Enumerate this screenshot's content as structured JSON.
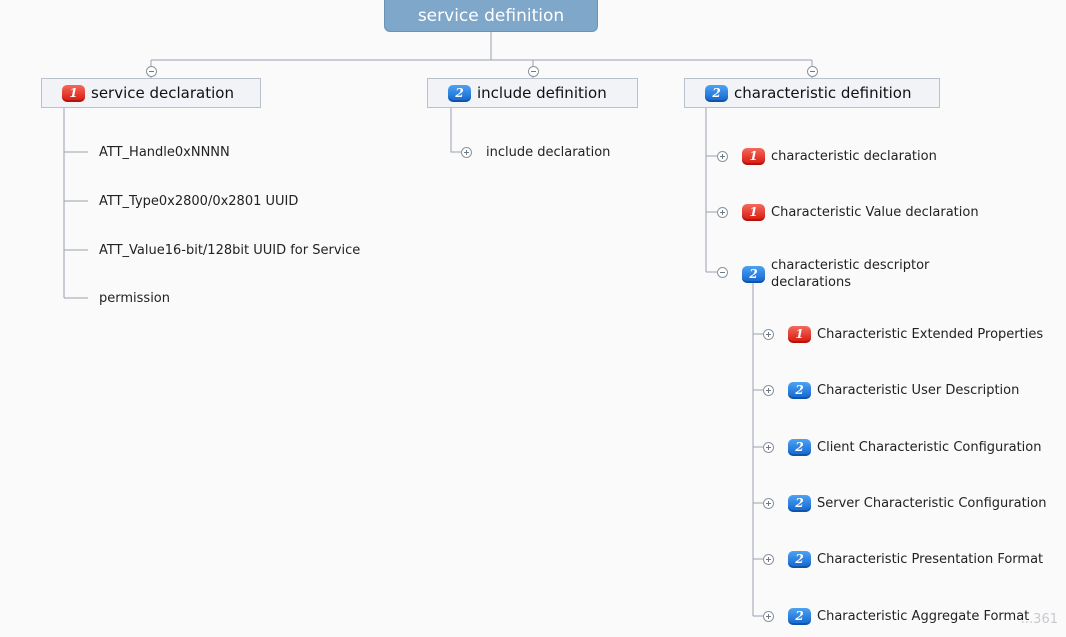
{
  "root": {
    "label": "service definition"
  },
  "branches": {
    "service_declaration": {
      "label": "service declaration",
      "badge": "1",
      "children": [
        "ATT_Handle0xNNNN",
        "ATT_Type0x2800/0x2801 UUID",
        "ATT_Value16-bit/128bit UUID for Service",
        "permission"
      ]
    },
    "include_definition": {
      "label": "include definition",
      "badge": "2",
      "children": [
        "include declaration"
      ]
    },
    "characteristic_definition": {
      "label": "characteristic definition",
      "badge": "2",
      "children": [
        {
          "label": "characteristic declaration",
          "badge": "1"
        },
        {
          "label": "Characteristic Value declaration",
          "badge": "1"
        },
        {
          "label": "characteristic descriptor declarations",
          "badge": "2"
        }
      ],
      "descriptors": [
        {
          "label": "Characteristic Extended Properties",
          "badge": "1"
        },
        {
          "label": "Characteristic User Description",
          "badge": "2"
        },
        {
          "label": "Client Characteristic Configuration",
          "badge": "2"
        },
        {
          "label": "Server Characteristic Configuration",
          "badge": "2"
        },
        {
          "label": "Characteristic Presentation Format",
          "badge": "2"
        },
        {
          "label": "Characteristic Aggregate Format",
          "badge": "2"
        }
      ]
    }
  },
  "watermark": "...361",
  "colors": {
    "root_bg": "#7fa7c9",
    "priority1": "#d8140a",
    "priority2": "#1064cf",
    "line": "#9aa3ad"
  }
}
